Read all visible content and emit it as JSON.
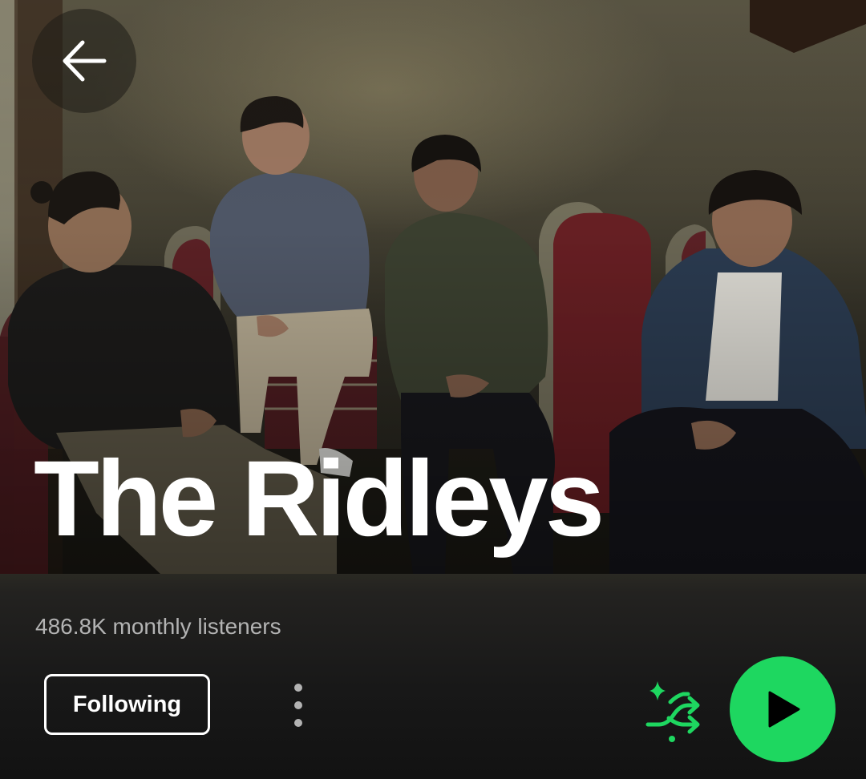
{
  "artist": {
    "name": "The Ridleys",
    "monthly_listeners": "486.8K monthly listeners"
  },
  "header": {
    "back_icon": "arrow-left-icon"
  },
  "actions": {
    "follow_label": "Following",
    "more_icon": "more-vertical-icon",
    "shuffle_icon": "smart-shuffle-icon",
    "play_icon": "play-icon"
  },
  "colors": {
    "accent": "#1ed760",
    "background": "#121212",
    "text_primary": "#ffffff",
    "text_secondary": "#b3b3b3"
  }
}
